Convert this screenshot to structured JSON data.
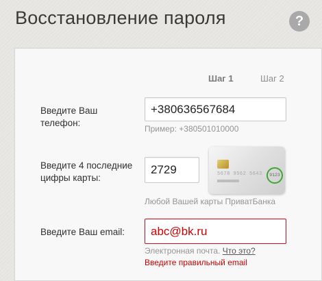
{
  "page": {
    "title": "Восстановление пароля",
    "help_icon": "?"
  },
  "steps": [
    {
      "label": "Шаг 1",
      "active": true
    },
    {
      "label": "Шаг 2",
      "active": false
    }
  ],
  "phone": {
    "label": "Введите Ваш телефон:",
    "value": "+380636567684",
    "hint": "Пример: +380501010000"
  },
  "card": {
    "label": "Введите 4 последние цифры карты:",
    "value": "2729",
    "hint": "Любой Вашей карты ПриватБанка",
    "image_icon": "bank-card-icon"
  },
  "email": {
    "label": "Введите Ваш email:",
    "value": "abc@bk.ru",
    "hint": "Электронная почта.",
    "what_link": "Что это?",
    "error": "Введите правильный email"
  },
  "colors": {
    "error": "#cc0000",
    "highlight_ring": "#3fa535"
  }
}
